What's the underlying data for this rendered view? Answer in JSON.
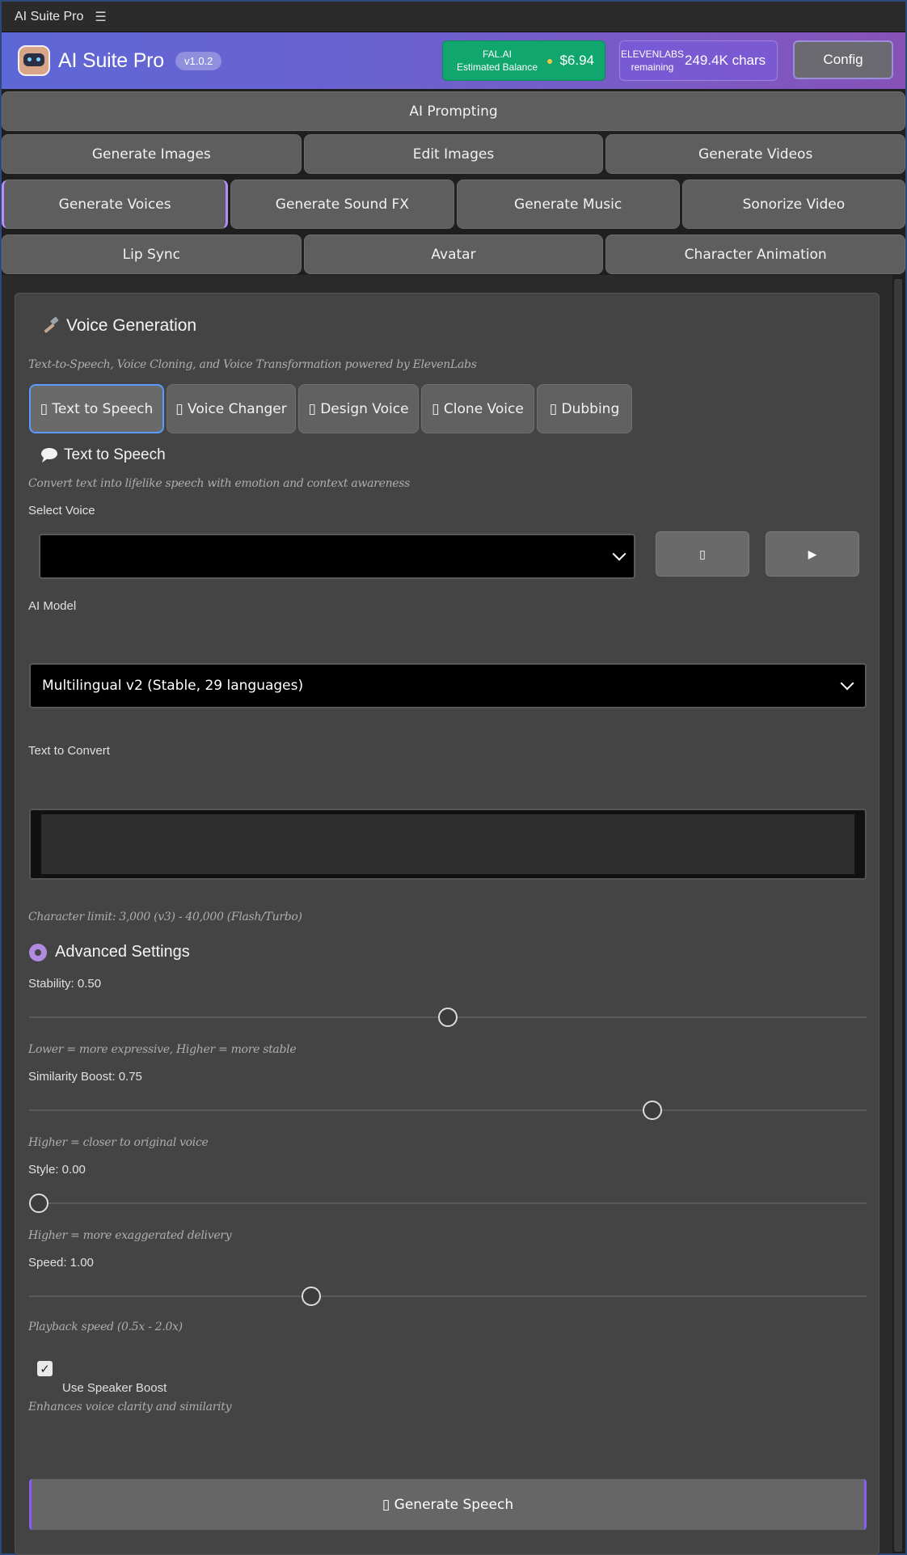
{
  "window": {
    "title": "AI Suite Pro",
    "menu_glyph": "☰"
  },
  "header": {
    "brand": "AI Suite Pro",
    "version": "v1.0.2",
    "fal": {
      "line1": "FAL.AI",
      "line2": "Estimated Balance",
      "icon": "moneybag-icon",
      "amount": "$6.94"
    },
    "elevenlabs": {
      "line1": "ELEVENLABS",
      "line2": "remaining",
      "amount": "249.4K chars"
    },
    "config_label": "Config"
  },
  "tabs": {
    "row1": [
      "AI Prompting"
    ],
    "row2": [
      "Generate Images",
      "Edit Images",
      "Generate Videos"
    ],
    "row3": [
      "Generate Voices",
      "Generate Sound FX",
      "Generate Music",
      "Sonorize Video"
    ],
    "row4": [
      "Lip Sync",
      "Avatar",
      "Character Animation"
    ],
    "active": "Generate Voices"
  },
  "voice": {
    "title": "Voice Generation",
    "subtitle": "Text-to-Speech, Voice Cloning, and Voice Transformation powered by ElevenLabs",
    "subtabs": [
      "▯ Text to Speech",
      "▯ Voice Changer",
      "▯ Design Voice",
      "▯ Clone Voice",
      "▯ Dubbing"
    ],
    "active_subtab": "Text to Speech",
    "tts": {
      "title": "Text to Speech",
      "subtitle": "Convert text into lifelike speech with emotion and context awareness",
      "select_voice_label": "Select Voice",
      "select_voice_value": "",
      "refresh_glyph": "▯",
      "play_glyph": "▶",
      "model_label": "AI Model",
      "model_value": "Multilingual v2 (Stable, 29 languages)",
      "text_label": "Text to Convert",
      "text_value": "",
      "char_limit": "Character limit: 3,000 (v3) - 40,000 (Flash/Turbo)"
    },
    "advanced": {
      "title": "Advanced Settings",
      "stability": {
        "label": "Stability: 0.50",
        "value": 0.5,
        "hint": "Lower = more expressive, Higher = more stable"
      },
      "similarity": {
        "label": "Similarity Boost: 0.75",
        "value": 0.75,
        "hint": "Higher = closer to original voice"
      },
      "style": {
        "label": "Style: 0.00",
        "value": 0.0,
        "hint": "Higher = more exaggerated delivery"
      },
      "speed": {
        "label": "Speed: 1.00",
        "value": 1.0,
        "hint": "Playback speed (0.5x - 2.0x)"
      },
      "speaker_boost": {
        "label": "Use Speaker Boost",
        "checked": true,
        "hint": "Enhances voice clarity and similarity"
      }
    },
    "generate_label": "▯ Generate Speech"
  }
}
